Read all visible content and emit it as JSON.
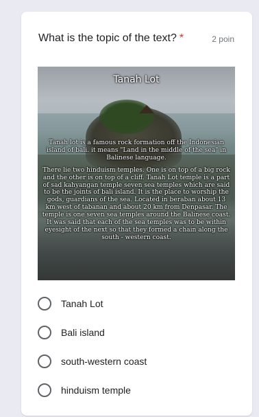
{
  "question": {
    "title": "What is the topic of the text?",
    "required_mark": "*",
    "points": "2 poin"
  },
  "image": {
    "title": "Tanah Lot",
    "paragraphs": [
      "Tanah lot is a famous rock formation off the Indonesian island of bali. it means \"Land in the middle of the sea\" in Balinese language.",
      "There lie two hinduism temples. One is on top of a big rock and the other is on top of a cliff. Tanah Lot temple is a part of sad kahyangan temple seven sea temples which are said to be the joints of bali island. It is the place to worship the gods, guardians of the sea. Located in beraban about 13 km west of tabanan and about 20 km from Denpasar. The temple is one seven sea temples around the Balinese coast. It was said that each of the sea temples was to be within eyesight of the next so that they formed a chain along the south - western coast."
    ]
  },
  "options": [
    {
      "label": "Tanah Lot"
    },
    {
      "label": "Bali island"
    },
    {
      "label": "south-western coast"
    },
    {
      "label": "hinduism temple"
    }
  ],
  "colors": {
    "required": "#d93025",
    "background": "#eaeaf2",
    "card": "#ffffff"
  }
}
